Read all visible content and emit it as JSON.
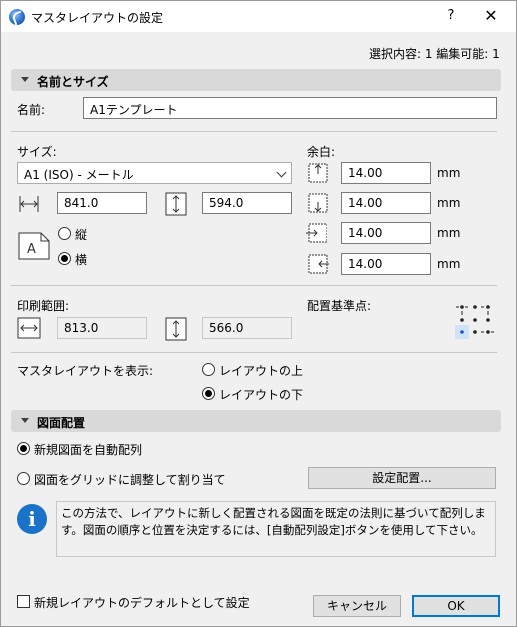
{
  "window": {
    "title": "マスタレイアウトの設定",
    "help_label": "?",
    "close_label": "✕"
  },
  "status": "選択内容: 1 編集可能: 1",
  "name_size_section": {
    "header": "名前とサイズ",
    "name_label": "名前:",
    "name_value": "A1テンプレート"
  },
  "size": {
    "label": "サイズ:",
    "preset_value": "A1 (ISO) - メートル",
    "width_value": "841.0",
    "height_value": "594.0",
    "orientation_options": [
      {
        "label": "縦",
        "selected": false
      },
      {
        "label": "横",
        "selected": true
      }
    ]
  },
  "margins": {
    "label": "余白:",
    "unit": "mm",
    "top": "14.00",
    "bottom": "14.00",
    "left": "14.00",
    "right": "14.00"
  },
  "printable_area": {
    "label": "印刷範囲:",
    "width_value": "813.0",
    "height_value": "566.0"
  },
  "anchor_point": {
    "label": "配置基準点:",
    "selected": "bottom-left"
  },
  "master_display": {
    "label": "マスタレイアウトを表示:",
    "options": [
      {
        "label": "レイアウトの上",
        "selected": false
      },
      {
        "label": "レイアウトの下",
        "selected": true
      }
    ]
  },
  "drawing_placement": {
    "header": "図面配置",
    "auto_arrange_label": "新規図面を自動配列",
    "auto_arrange_selected": true,
    "grid_fit_label": "図面をグリッドに調整して割り当て",
    "grid_fit_selected": false,
    "settings_button": "設定配置...",
    "info_text": "この方法で、レイアウトに新しく配置される図面を既定の法則に基づいて配列します。図面の順序と位置を決定するには、[自動配列設定]ボタンを使用して下さい。"
  },
  "footer": {
    "default_checkbox_label": "新規レイアウトのデフォルトとして設定",
    "default_checked": false,
    "cancel_label": "キャンセル",
    "ok_label": "OK"
  },
  "colors": {
    "accent": "#0078d7",
    "info_icon": "#1a73c9"
  }
}
